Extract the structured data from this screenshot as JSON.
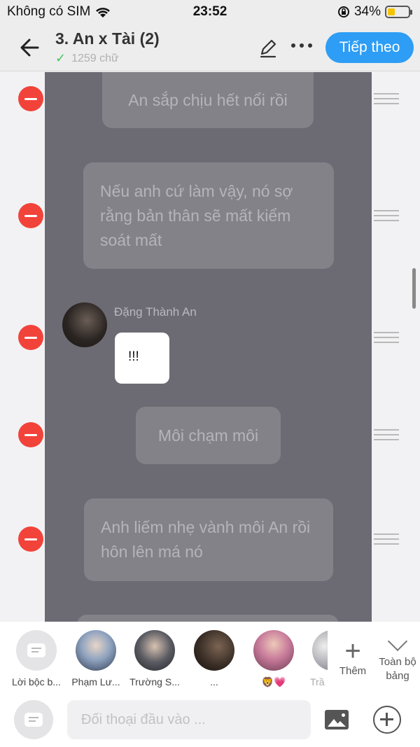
{
  "status_bar": {
    "carrier": "Không có SIM",
    "time": "23:52",
    "battery": "34%",
    "battery_level": 0.34,
    "battery_color": "#f5c400"
  },
  "header": {
    "title": "3. An x Tài (2)",
    "word_count": "1259 chữ",
    "next_label": "Tiếp theo",
    "accent": "#2d9df5"
  },
  "messages": [
    {
      "type": "narration",
      "text": "An sắp chịu hết nổi rồi"
    },
    {
      "type": "narration",
      "text": "Nếu anh cứ làm vậy, nó sợ rằng bản thân sẽ mất kiểm soát mất"
    },
    {
      "type": "character",
      "name": "Đặng Thành An",
      "text": "!!!"
    },
    {
      "type": "narration",
      "text": "Môi chạm môi"
    },
    {
      "type": "narration",
      "text": "Anh liếm nhẹ vành môi An rồi hôn lên má nó"
    }
  ],
  "characters": [
    {
      "name": "Lời bộc b..."
    },
    {
      "name": "Phạm Lư..."
    },
    {
      "name": "Trường S..."
    },
    {
      "name": "..."
    },
    {
      "name": "🦁💗"
    },
    {
      "name": "Trầ"
    }
  ],
  "bottom": {
    "add_label": "Thêm",
    "all_label": "Toàn bộ bảng",
    "input_placeholder": "Đối thoại đầu vào ..."
  },
  "colors": {
    "delete": "#f2433b",
    "chat_background": "#6c6b73"
  }
}
